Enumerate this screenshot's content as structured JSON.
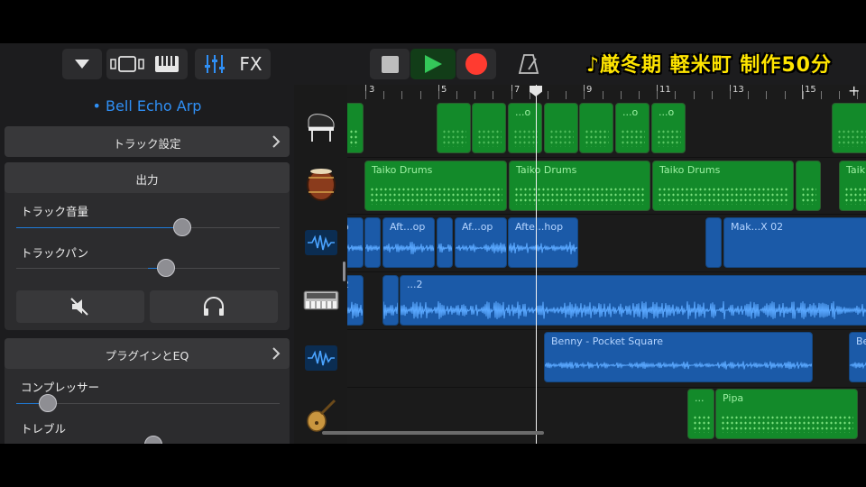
{
  "caption": "♪厳冬期 軽米町 制作50分",
  "toolbar": {
    "view_icons": [
      "browser-dropdown-icon",
      "tracks-view-icon",
      "keyboard-icon",
      "mixer-icon"
    ],
    "fx_label": "FX",
    "transport": [
      "stop-icon",
      "play-icon",
      "record-icon"
    ],
    "metronome_icon": "metronome-icon",
    "play_color": "#34c759",
    "record_color": "#ff3b30"
  },
  "panel": {
    "track_name": "• Bell Echo Arp",
    "track_settings_label": "トラック設定",
    "output_header": "出力",
    "volume_label": "トラック音量",
    "volume_level": 0.63,
    "pan_label": "トラックパン",
    "pan_level": 0.57,
    "mute_icon": "mute-speaker-icon",
    "solo_icon": "headphones-icon",
    "plugins_label": "プラグインとEQ",
    "compressor_label": "コンプレッサー",
    "compressor_level": 0.12,
    "treble_label": "トレブル",
    "treble_level": 0.52
  },
  "ruler": {
    "marks": [
      "3",
      "5",
      "7",
      "9",
      "11",
      "13",
      "15"
    ],
    "add_label": "+"
  },
  "tracks": [
    {
      "icon": "grand-piano-icon",
      "type": "midi"
    },
    {
      "icon": "taiko-drum-icon",
      "type": "midi"
    },
    {
      "icon": "audio-waveform-icon",
      "type": "audio"
    },
    {
      "icon": "synth-keyboard-icon",
      "type": "audio"
    },
    {
      "icon": "audio-waveform-icon",
      "type": "audio"
    },
    {
      "icon": "pipa-icon",
      "type": "midi"
    }
  ],
  "regions": {
    "piano": [
      "",
      "",
      "",
      "...o",
      "",
      "",
      "...o",
      "...o"
    ],
    "taiko": [
      "Taiko Drums",
      "Taiko Drums",
      "Taiko Drums",
      "",
      "Taik"
    ],
    "aft": [
      "o",
      "",
      "Aft...op",
      "",
      "Af...op",
      "Afte...hop",
      "",
      "Mak...X 02"
    ],
    "synth": [
      "2",
      "...2"
    ],
    "benny": [
      "Benny - Pocket Square",
      "Be"
    ],
    "pipa": [
      "...",
      "Pipa"
    ]
  }
}
